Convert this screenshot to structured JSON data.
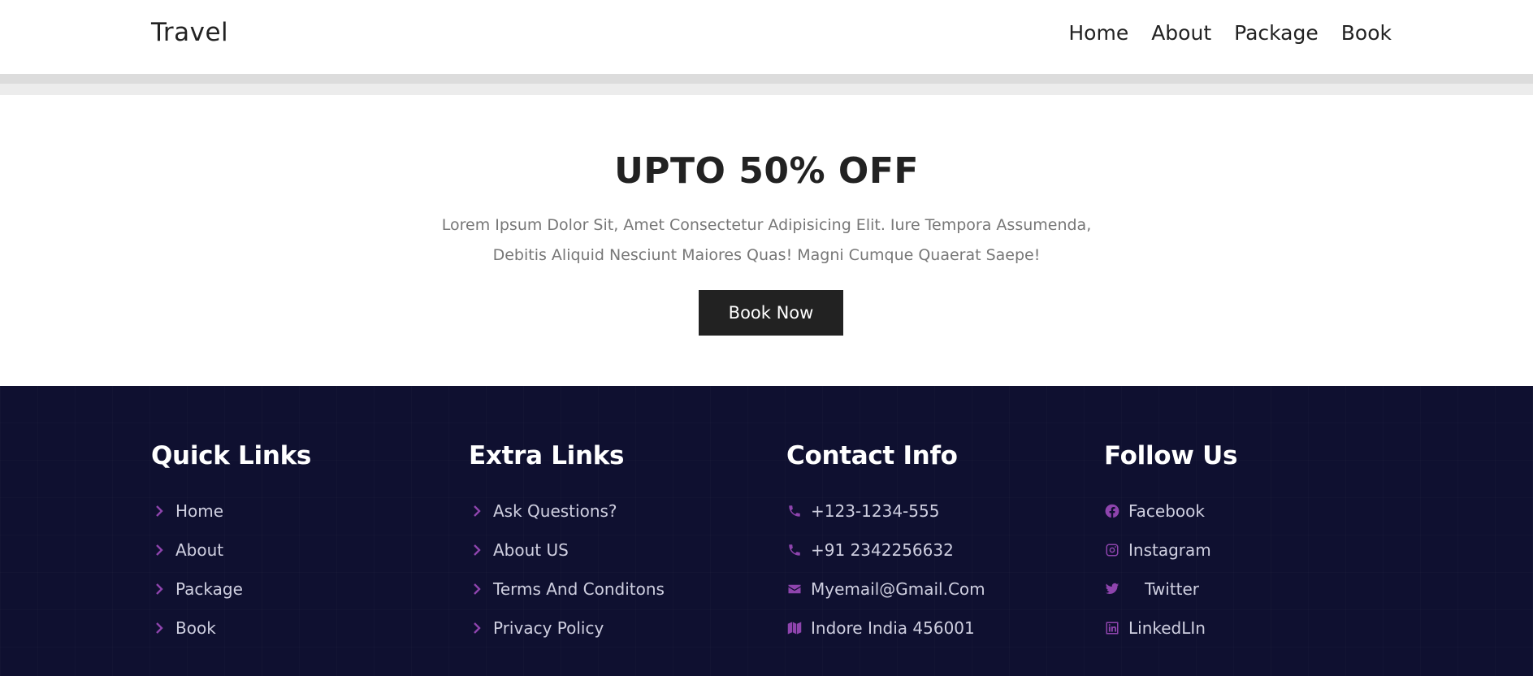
{
  "header": {
    "brand": "Travel",
    "nav": [
      "Home",
      "About",
      "Package",
      "Book"
    ]
  },
  "hero": {
    "title": "UPTO 50% OFF",
    "text": "Lorem Ipsum Dolor Sit, Amet Consectetur Adipisicing Elit. Iure Tempora Assumenda, Debitis Aliquid Nesciunt Maiores Quas! Magni Cumque Quaerat Saepe!",
    "button": "Book Now"
  },
  "footer": {
    "quick_links": {
      "title": "Quick Links",
      "items": [
        "Home",
        "About",
        "Package",
        "Book"
      ]
    },
    "extra_links": {
      "title": "Extra Links",
      "items": [
        "Ask Questions?",
        "About US",
        "Terms And Conditons",
        "Privacy Policy"
      ]
    },
    "contact": {
      "title": "Contact Info",
      "items": [
        {
          "icon": "phone-icon",
          "text": "+123-1234-555"
        },
        {
          "icon": "phone-icon",
          "text": "+91 2342256632"
        },
        {
          "icon": "envelope-icon",
          "text": "Myemail@Gmail.Com"
        },
        {
          "icon": "map-icon",
          "text": "Indore India 456001"
        }
      ]
    },
    "follow": {
      "title": "Follow Us",
      "items": [
        {
          "icon": "facebook-icon",
          "text": "Facebook"
        },
        {
          "icon": "instagram-icon",
          "text": "Instagram"
        },
        {
          "icon": "twitter-icon",
          "text": "Twitter"
        },
        {
          "icon": "linkedin-icon",
          "text": "LinkedLIn"
        }
      ]
    }
  },
  "colors": {
    "accent": "#8e44ad",
    "footer_bg": "#0f1030",
    "button_bg": "#222222"
  }
}
